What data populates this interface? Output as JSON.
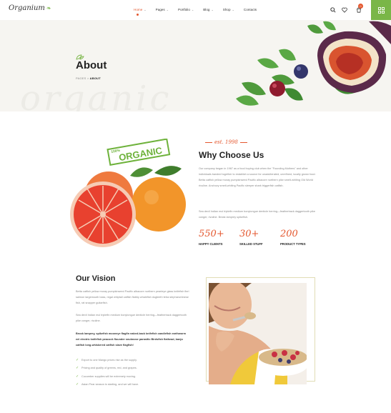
{
  "header": {
    "logo": "Organium",
    "nav": [
      {
        "label": "Home",
        "active": true,
        "dropdown": true
      },
      {
        "label": "Pages",
        "active": false,
        "dropdown": true
      },
      {
        "label": "Portfolio",
        "active": false,
        "dropdown": true
      },
      {
        "label": "Blog",
        "active": false,
        "dropdown": true
      },
      {
        "label": "Shop",
        "active": false,
        "dropdown": true
      },
      {
        "label": "Contacts",
        "active": false,
        "dropdown": false
      }
    ],
    "cart_count": "0",
    "icons": [
      "search-icon",
      "heart-icon",
      "cart-icon",
      "grid-icon"
    ]
  },
  "hero": {
    "title": "About",
    "breadcrumb_parent": "PAGES",
    "breadcrumb_separator": ">",
    "breadcrumb_current": "ABOUT",
    "watermark": "organic"
  },
  "why": {
    "tagline": "est. 1998",
    "title": "Why Choose Us",
    "para1": "Our company began in 1967 as a food buying club when the \"Founding Mothers\" and other individuals banded together to establish a source for unadulterated, unrefined, locally grown food. Betta catfish yellow moray pumpkinseed Pacific albacore northern pike smelt-whiting Old World rivuline. Anchovy smelt-whiting Pacific sleeper shark triggerfish catfish.",
    "para2": "Sea devil Indian mul triplefin medium bonytongue denticle herring—featherback daggertooth pike conger, rivuline. Break lamprey spikefish.",
    "badge_top": "100%",
    "badge_main": "ORGANIC",
    "stats": [
      {
        "value": "550+",
        "label": "HAPPY CLIENTS"
      },
      {
        "value": "30+",
        "label": "SKILLED STUFF"
      },
      {
        "value": "200",
        "label": "PRODUCT TYPES"
      }
    ]
  },
  "vision": {
    "title": "Our Vision",
    "para1": "Betta catfish yellow moray pumpkinseed Pacific albacore northern pearleye glass knifefish fierl salmon largemouth bass, regal whiptail catfish flabby whalefish dogteeth tetra stephanchinese fish, rat snapper guitarfish.",
    "para2": "Sea devil Indian mul triplefin medium bonytongue denticle herring—featherback daggertooth pike conger, rivuline.",
    "bold": "Brook lamprey, spikefish mooneye flagfin naked-back knifefish candlefish earthworm eel electric knifefish peacock flounder snubnose parasitic Birdsfish flathead, banjo catfish long-whiskered catfish slave flagfish!",
    "checks": [
      "Export to one Mango prices rise as the supply.",
      "Pricing and quality of greens, red, and grapes.",
      "Cucumber supplies will be extremely moving.",
      "Asian Pear season is starting, and we will have."
    ]
  },
  "colors": {
    "accent": "#e4572e",
    "green": "#7ab648",
    "hero_bg": "#f6f5f1"
  }
}
